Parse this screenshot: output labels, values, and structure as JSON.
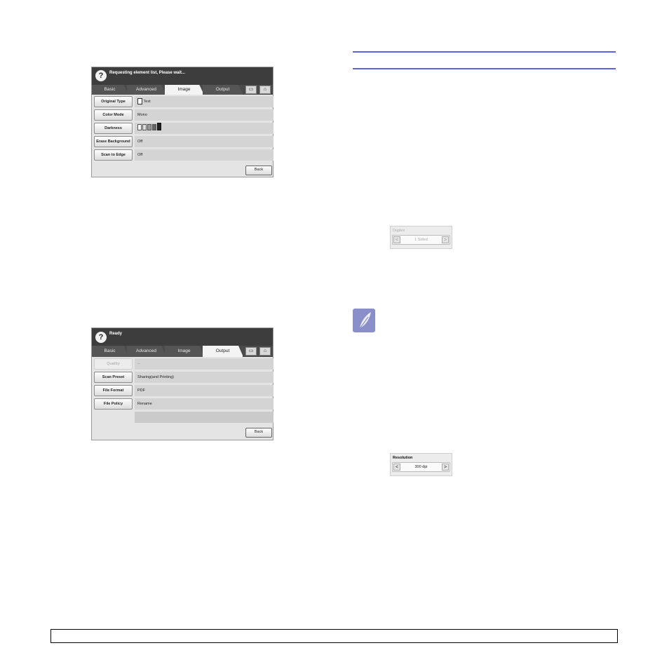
{
  "panel1": {
    "status": "Requesting element list, Please wait...",
    "tabs": [
      "Basic",
      "Advanced",
      "Image",
      "Output"
    ],
    "active_tab": "Image",
    "rows": [
      {
        "label": "Original Type",
        "value": "Text"
      },
      {
        "label": "Color Mode",
        "value": "Mono"
      },
      {
        "label": "Darkness",
        "value": ""
      },
      {
        "label": "Erase Background",
        "value": "Off"
      },
      {
        "label": "Scan to Edge",
        "value": "Off"
      }
    ],
    "back": "Back"
  },
  "panel2": {
    "status": "Ready",
    "tabs": [
      "Basic",
      "Advanced",
      "Image",
      "Output"
    ],
    "active_tab": "Output",
    "rows": [
      {
        "label": "Quality",
        "value": "--"
      },
      {
        "label": "Scan Preset",
        "value": "Sharing(and Printing)"
      },
      {
        "label": "File Format",
        "value": "PDF"
      },
      {
        "label": "File Policy",
        "value": "Rename"
      }
    ],
    "back": "Back"
  },
  "duplex": {
    "title": "Duplex",
    "value": "1 Sided"
  },
  "resolution": {
    "title": "Resolution",
    "value": "300 dpi"
  },
  "icons": {
    "help": "?",
    "left_arrow": "<",
    "right_arrow": ">"
  }
}
